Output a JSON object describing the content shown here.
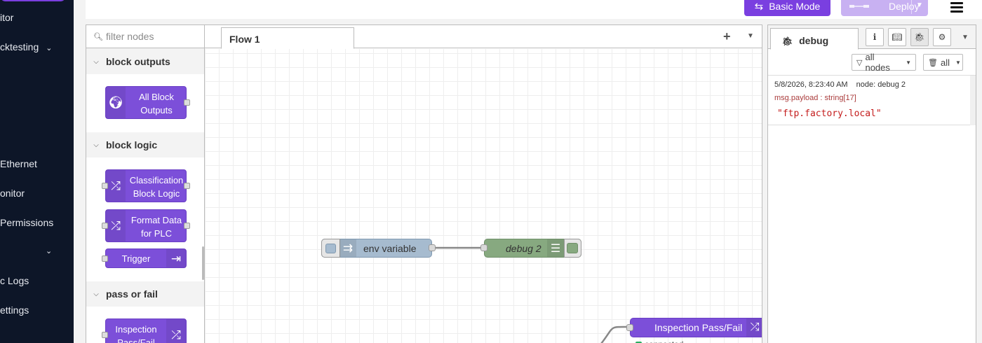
{
  "nav": {
    "items": [
      {
        "label": "itor",
        "chevron": false
      },
      {
        "label": "cktesting",
        "chevron": true
      },
      {
        "label": "Ethernet",
        "chevron": false
      },
      {
        "label": "onitor",
        "chevron": false
      },
      {
        "label": " Permissions",
        "chevron": false
      },
      {
        "label": "",
        "chevron": true
      },
      {
        "label": "c Logs",
        "chevron": false
      },
      {
        "label": "ettings",
        "chevron": false
      }
    ]
  },
  "header": {
    "basic_mode_label": "Basic Mode",
    "deploy_label": "Deploy",
    "colors": {
      "accent": "#7a3fe0",
      "deploy_disabled": "#c8b1f2"
    }
  },
  "palette": {
    "filter_placeholder": "filter nodes",
    "categories": [
      {
        "name": "block outputs",
        "nodes": [
          "All Block Outputs"
        ]
      },
      {
        "name": "block logic",
        "nodes": [
          "Classification Block Logic",
          "Format Data for PLC",
          "Trigger"
        ]
      },
      {
        "name": "pass or fail",
        "nodes": [
          "Inspection Pass/Fail"
        ]
      }
    ],
    "node_labels": {
      "all_block_outputs": [
        "All Block",
        "Outputs"
      ],
      "classification": [
        "Classification",
        "Block Logic"
      ],
      "format_data": [
        "Format Data",
        "for PLC"
      ],
      "trigger": "Trigger",
      "inspection": [
        "Inspection",
        "Pass/Fail"
      ]
    }
  },
  "workspace": {
    "tabs": [
      {
        "label": "Flow 1",
        "active": true
      }
    ],
    "add_icon": "plus-icon",
    "nodes": {
      "env": {
        "label": "env variable",
        "color": "#a6bbcf",
        "icon": "inject-icon"
      },
      "debug": {
        "label": "debug 2",
        "color": "#87a980",
        "icon": "list-icon"
      },
      "inspection": {
        "label": "Inspection Pass/Fail",
        "color": "#7c4fd9",
        "icon": "shuffle-icon",
        "status": "connected",
        "status_color": "#27ae60"
      }
    }
  },
  "sidebar": {
    "active_tab": "debug",
    "buttons": [
      "info-icon",
      "book-icon",
      "bug-icon",
      "gear-icon"
    ],
    "filter_nodes_label": "all nodes",
    "clear_label": "all",
    "messages": [
      {
        "timestamp": "5/8/2026, 8:23:40 AM",
        "node": "node: debug 2",
        "topic": "msg.payload : string[17]",
        "value": "\"ftp.factory.local\""
      }
    ]
  }
}
